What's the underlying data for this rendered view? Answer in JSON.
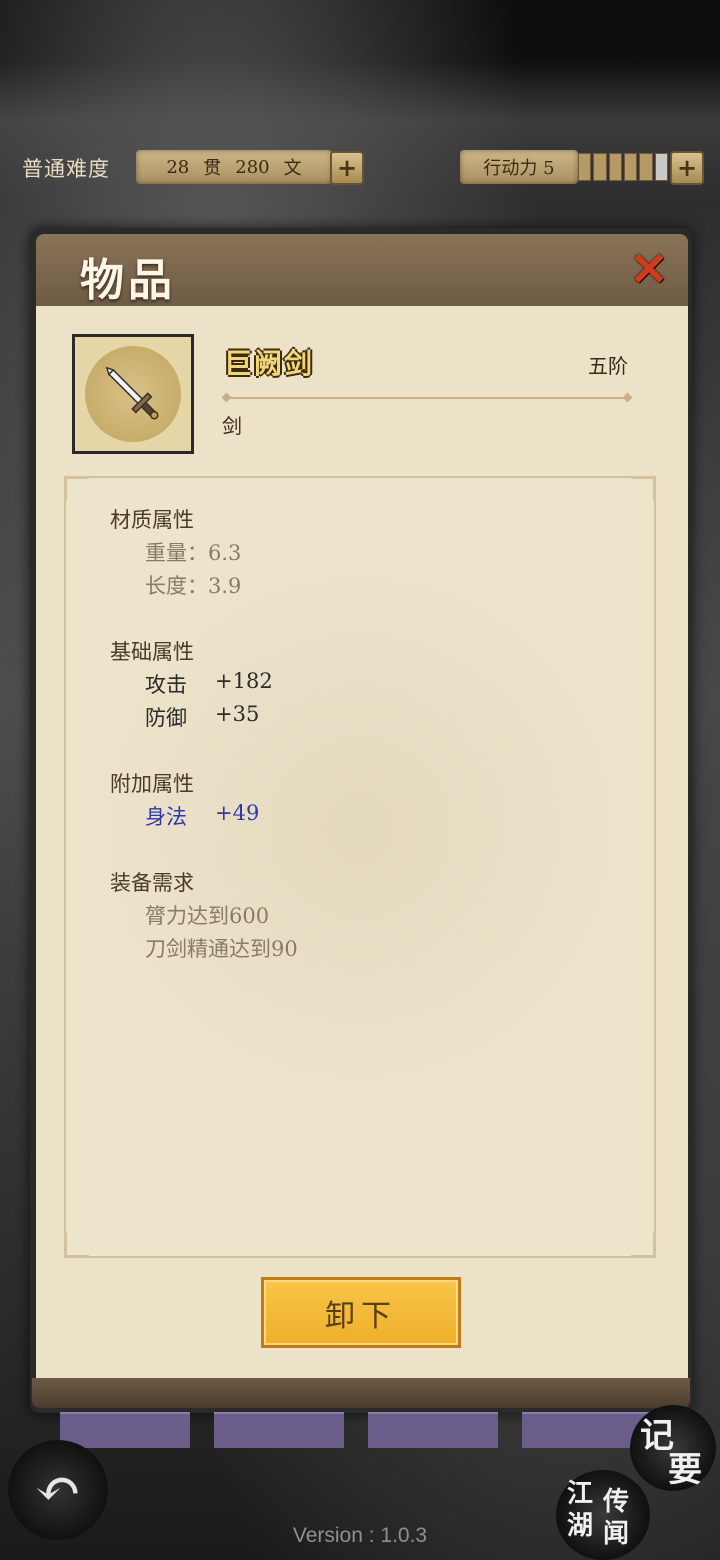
{
  "topbar": {
    "difficulty": "普通难度",
    "money": {
      "guan_value": "28",
      "guan_unit": "贯",
      "wen_value": "280",
      "wen_unit": "文"
    },
    "action_label": "行动力 5",
    "action_meter": {
      "filled": 5,
      "total": 6
    }
  },
  "panel": {
    "title": "物品"
  },
  "item": {
    "name": "巨阙剑",
    "grade": "五阶",
    "type": "剑",
    "icon": "sword-icon"
  },
  "sections": {
    "material": {
      "title": "材质属性",
      "weight": "重量：6.3",
      "length": "长度：3.9"
    },
    "base": {
      "title": "基础属性",
      "attack_label": "攻击",
      "attack_value": "+182",
      "defense_label": "防御",
      "defense_value": "+35"
    },
    "extra": {
      "title": "附加属性",
      "agility_label": "身法",
      "agility_value": "+49"
    },
    "requirement": {
      "title": "装备需求",
      "req1": "膂力达到600",
      "req2": "刀剑精通达到90"
    }
  },
  "actions": {
    "unequip_label": "卸下"
  },
  "nav": {
    "jiyao": [
      "记",
      "要"
    ],
    "jianghu": [
      "江",
      "湖",
      "传",
      "闻"
    ]
  },
  "version": "Version : 1.0.3",
  "colors": {
    "accent_button": "#f2b636",
    "item_name": "#f2d679",
    "bonus_stat": "#2d3aa8",
    "close_icon": "#d23a1c"
  }
}
